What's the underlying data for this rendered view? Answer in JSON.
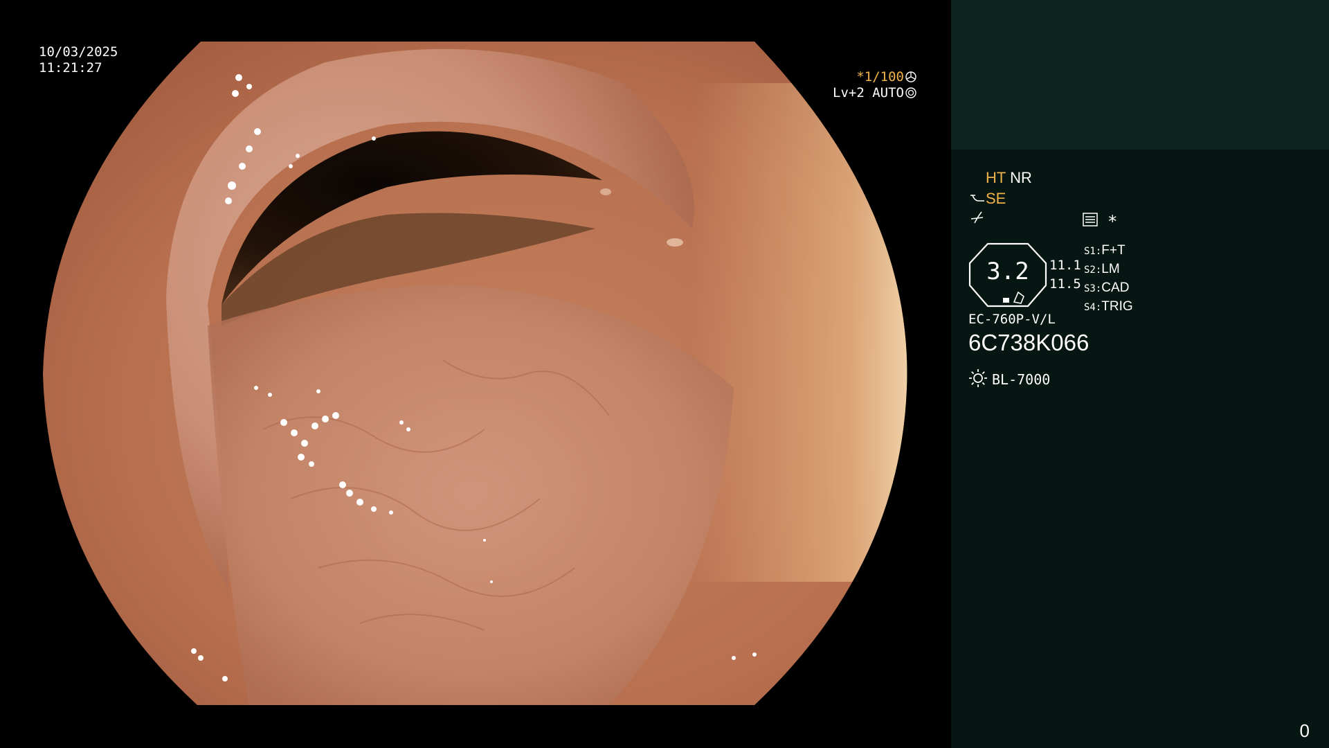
{
  "overlay": {
    "date": "10/03/2025",
    "time": "11:21:27",
    "shutter": "*1/100",
    "level": "Lv+2 AUTO"
  },
  "panel": {
    "mode_ht": "HT",
    "mode_nr": "NR",
    "mode_se": "SE",
    "asterisk": "*",
    "zoom_value": "3.2",
    "readout_1": "11.1",
    "readout_2": "11.5",
    "s_items": [
      {
        "key": "S1:",
        "value": "F+T"
      },
      {
        "key": "S2:",
        "value": "LM"
      },
      {
        "key": "S3:",
        "value": "CAD"
      },
      {
        "key": "S4:",
        "value": "TRIG"
      }
    ],
    "scope_model": "EC-760P-V/L",
    "scope_serial": "6C738K066",
    "light_source": "BL-7000",
    "counter": "0"
  },
  "colors": {
    "panel_bg": "#061612",
    "patient_box_bg": "#0e2421",
    "accent_orange": "#f2b24a",
    "tissue": "#c5785a"
  },
  "icons": {
    "shutter_icon": "aperture-icon",
    "auto_icon": "iris-icon",
    "memo_icon": "memo-icon",
    "light_icon": "sun-icon",
    "structure_icon": "structure-enhance-icon",
    "tone_icon": "tone-icon"
  }
}
